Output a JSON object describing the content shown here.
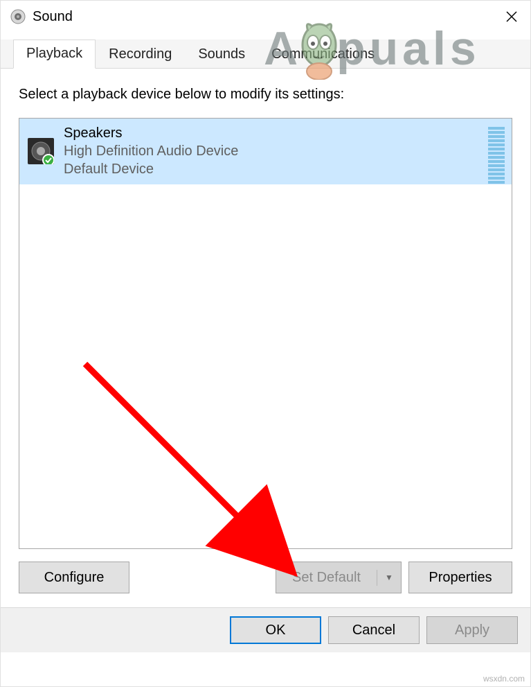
{
  "window": {
    "title": "Sound"
  },
  "tabs": [
    {
      "label": "Playback"
    },
    {
      "label": "Recording"
    },
    {
      "label": "Sounds"
    },
    {
      "label": "Communications"
    }
  ],
  "content": {
    "instruction": "Select a playback device below to modify its settings:"
  },
  "device": {
    "name": "Speakers",
    "description": "High Definition Audio Device",
    "status": "Default Device"
  },
  "buttons": {
    "configure": "Configure",
    "set_default": "Set Default",
    "properties": "Properties",
    "ok": "OK",
    "cancel": "Cancel",
    "apply": "Apply"
  },
  "watermark": {
    "part1": "A",
    "part2": "puals"
  },
  "footer_watermark": "wsxdn.com"
}
